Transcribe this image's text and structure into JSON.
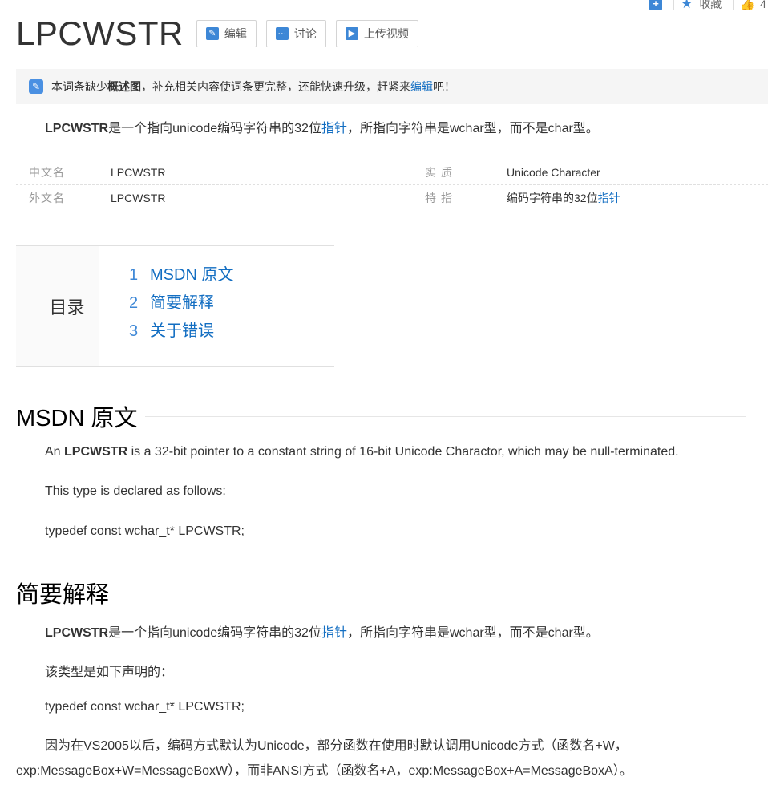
{
  "top_actions": {
    "add_icon": "plus-square-icon",
    "favorite_label": "收藏",
    "like_count": "4"
  },
  "title": "LPCWSTR",
  "buttons": {
    "edit": "编辑",
    "discuss": "讨论",
    "upload_video": "上传视频"
  },
  "notice": {
    "prefix": "本词条缺少",
    "bold": "概述图",
    "middle": "，补充相关内容使词条更完整，还能快速升级，赶紧来",
    "link": "编辑",
    "suffix": "吧！"
  },
  "summary": {
    "bold": "LPCWSTR",
    "text1": "是一个指向unicode编码字符串的32位",
    "link": "指针",
    "text2": "，所指向字符串是wchar型，而不是char型。"
  },
  "info": {
    "row1": {
      "k1": "中文名",
      "v1": "LPCWSTR",
      "k2": "实质",
      "v2": "Unicode Character"
    },
    "row2": {
      "k1": "外文名",
      "v1": "LPCWSTR",
      "k2": "特指",
      "v2_text": "编码字符串的32位",
      "v2_link": "指针"
    }
  },
  "catalog": {
    "label": "目录",
    "items": [
      {
        "num": "1",
        "text": "MSDN 原文"
      },
      {
        "num": "2",
        "text": "简要解释"
      },
      {
        "num": "3",
        "text": "关于错误"
      }
    ]
  },
  "section1": {
    "title": "MSDN 原文",
    "p1_pre": "An ",
    "p1_bold": "LPCWSTR",
    "p1_post": " is a 32-bit pointer to a constant string of 16-bit Unicode Charactor, which may be null-terminated.",
    "p2": "This type is declared as follows:",
    "p3": "typedef const wchar_t* LPCWSTR;"
  },
  "section2": {
    "title": "简要解释",
    "p1_bold": "LPCWSTR",
    "p1_text1": "是一个指向unicode编码字符串的32位",
    "p1_link": "指针",
    "p1_text2": "，所指向字符串是wchar型，而不是char型。",
    "p2": "该类型是如下声明的：",
    "p3": "typedef const wchar_t* LPCWSTR;",
    "p4_line1": "因为在VS2005以后，编码方式默认为Unicode，部分函数在使用时默认调用Unicode方式（函数名+W，",
    "p4_line2": "exp:MessageBox+W=MessageBoxW），而非ANSI方式（函数名+A，exp:MessageBox+A=MessageBoxA）。"
  }
}
